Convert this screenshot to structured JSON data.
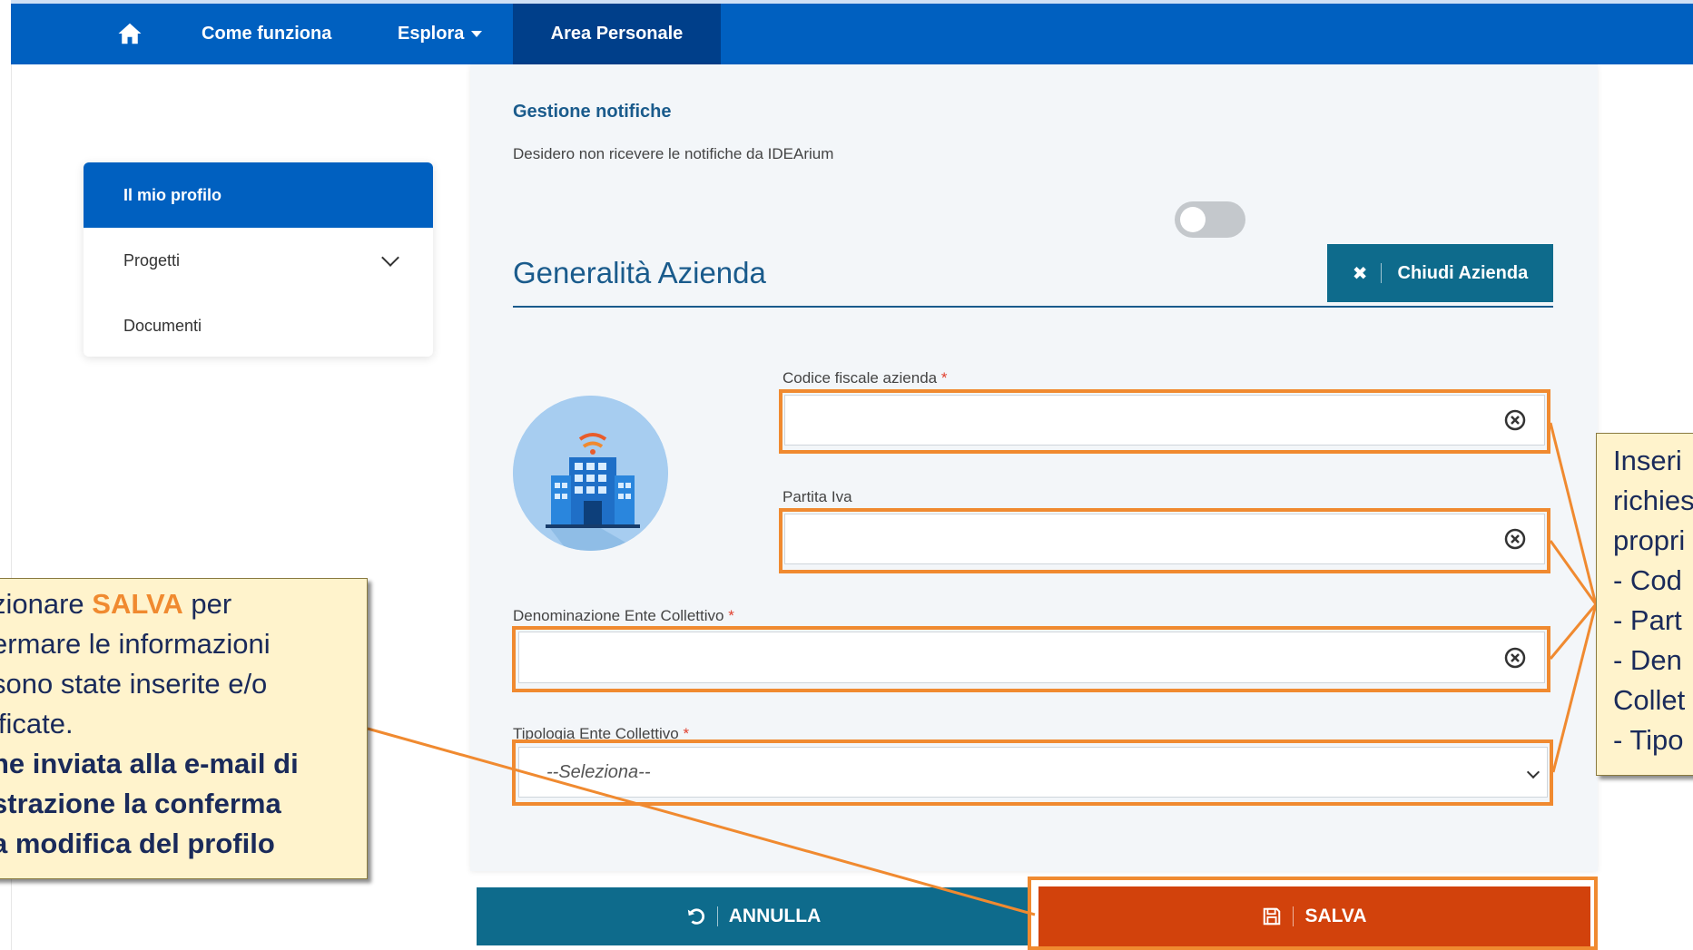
{
  "nav": {
    "come_funziona": "Come funziona",
    "esplora": "Esplora",
    "area_personale": "Area Personale"
  },
  "sidebar": {
    "items": [
      {
        "label": "Il mio profilo"
      },
      {
        "label": "Progetti"
      },
      {
        "label": "Documenti"
      }
    ]
  },
  "notifications": {
    "title": "Gestione notifiche",
    "description": "Desidero non ricevere le notifiche da IDEArium"
  },
  "company": {
    "title": "Generalità Azienda",
    "close_button": "Chiudi Azienda",
    "fields": {
      "codice_fiscale": {
        "label": "Codice fiscale azienda",
        "required": "*",
        "value": ""
      },
      "partita_iva": {
        "label": "Partita Iva",
        "value": ""
      },
      "denominazione": {
        "label": "Denominazione Ente Collettivo",
        "required": "*",
        "value": ""
      },
      "tipologia": {
        "label": "Tipologia Ente Collettivo",
        "required": "*",
        "selected": "--Seleziona--"
      }
    }
  },
  "actions": {
    "annulla": "ANNULLA",
    "salva": "SALVA"
  },
  "callouts": {
    "left": {
      "line1_pre": "zionare ",
      "line1_accent": "SALVA",
      "line1_post": " per",
      "line2": "ermare le informazioni",
      "line3": "sono state inserite e/o",
      "line4": "ificate.",
      "line5": "ne inviata alla e-mail di",
      "line6": "strazione la conferma",
      "line7": "a modifica del profilo"
    },
    "right": {
      "lines": [
        "Inseri",
        "richies",
        "propri",
        "- Cod",
        "- Part",
        "- Den",
        "Collet",
        "- Tipo"
      ]
    }
  },
  "colors": {
    "nav_bg": "#0060c0",
    "nav_active": "#003f8a",
    "teal_button": "#0e6b8c",
    "save_button": "#d2420c",
    "highlight": "#f08a30",
    "callout_bg": "#fff3cc"
  }
}
